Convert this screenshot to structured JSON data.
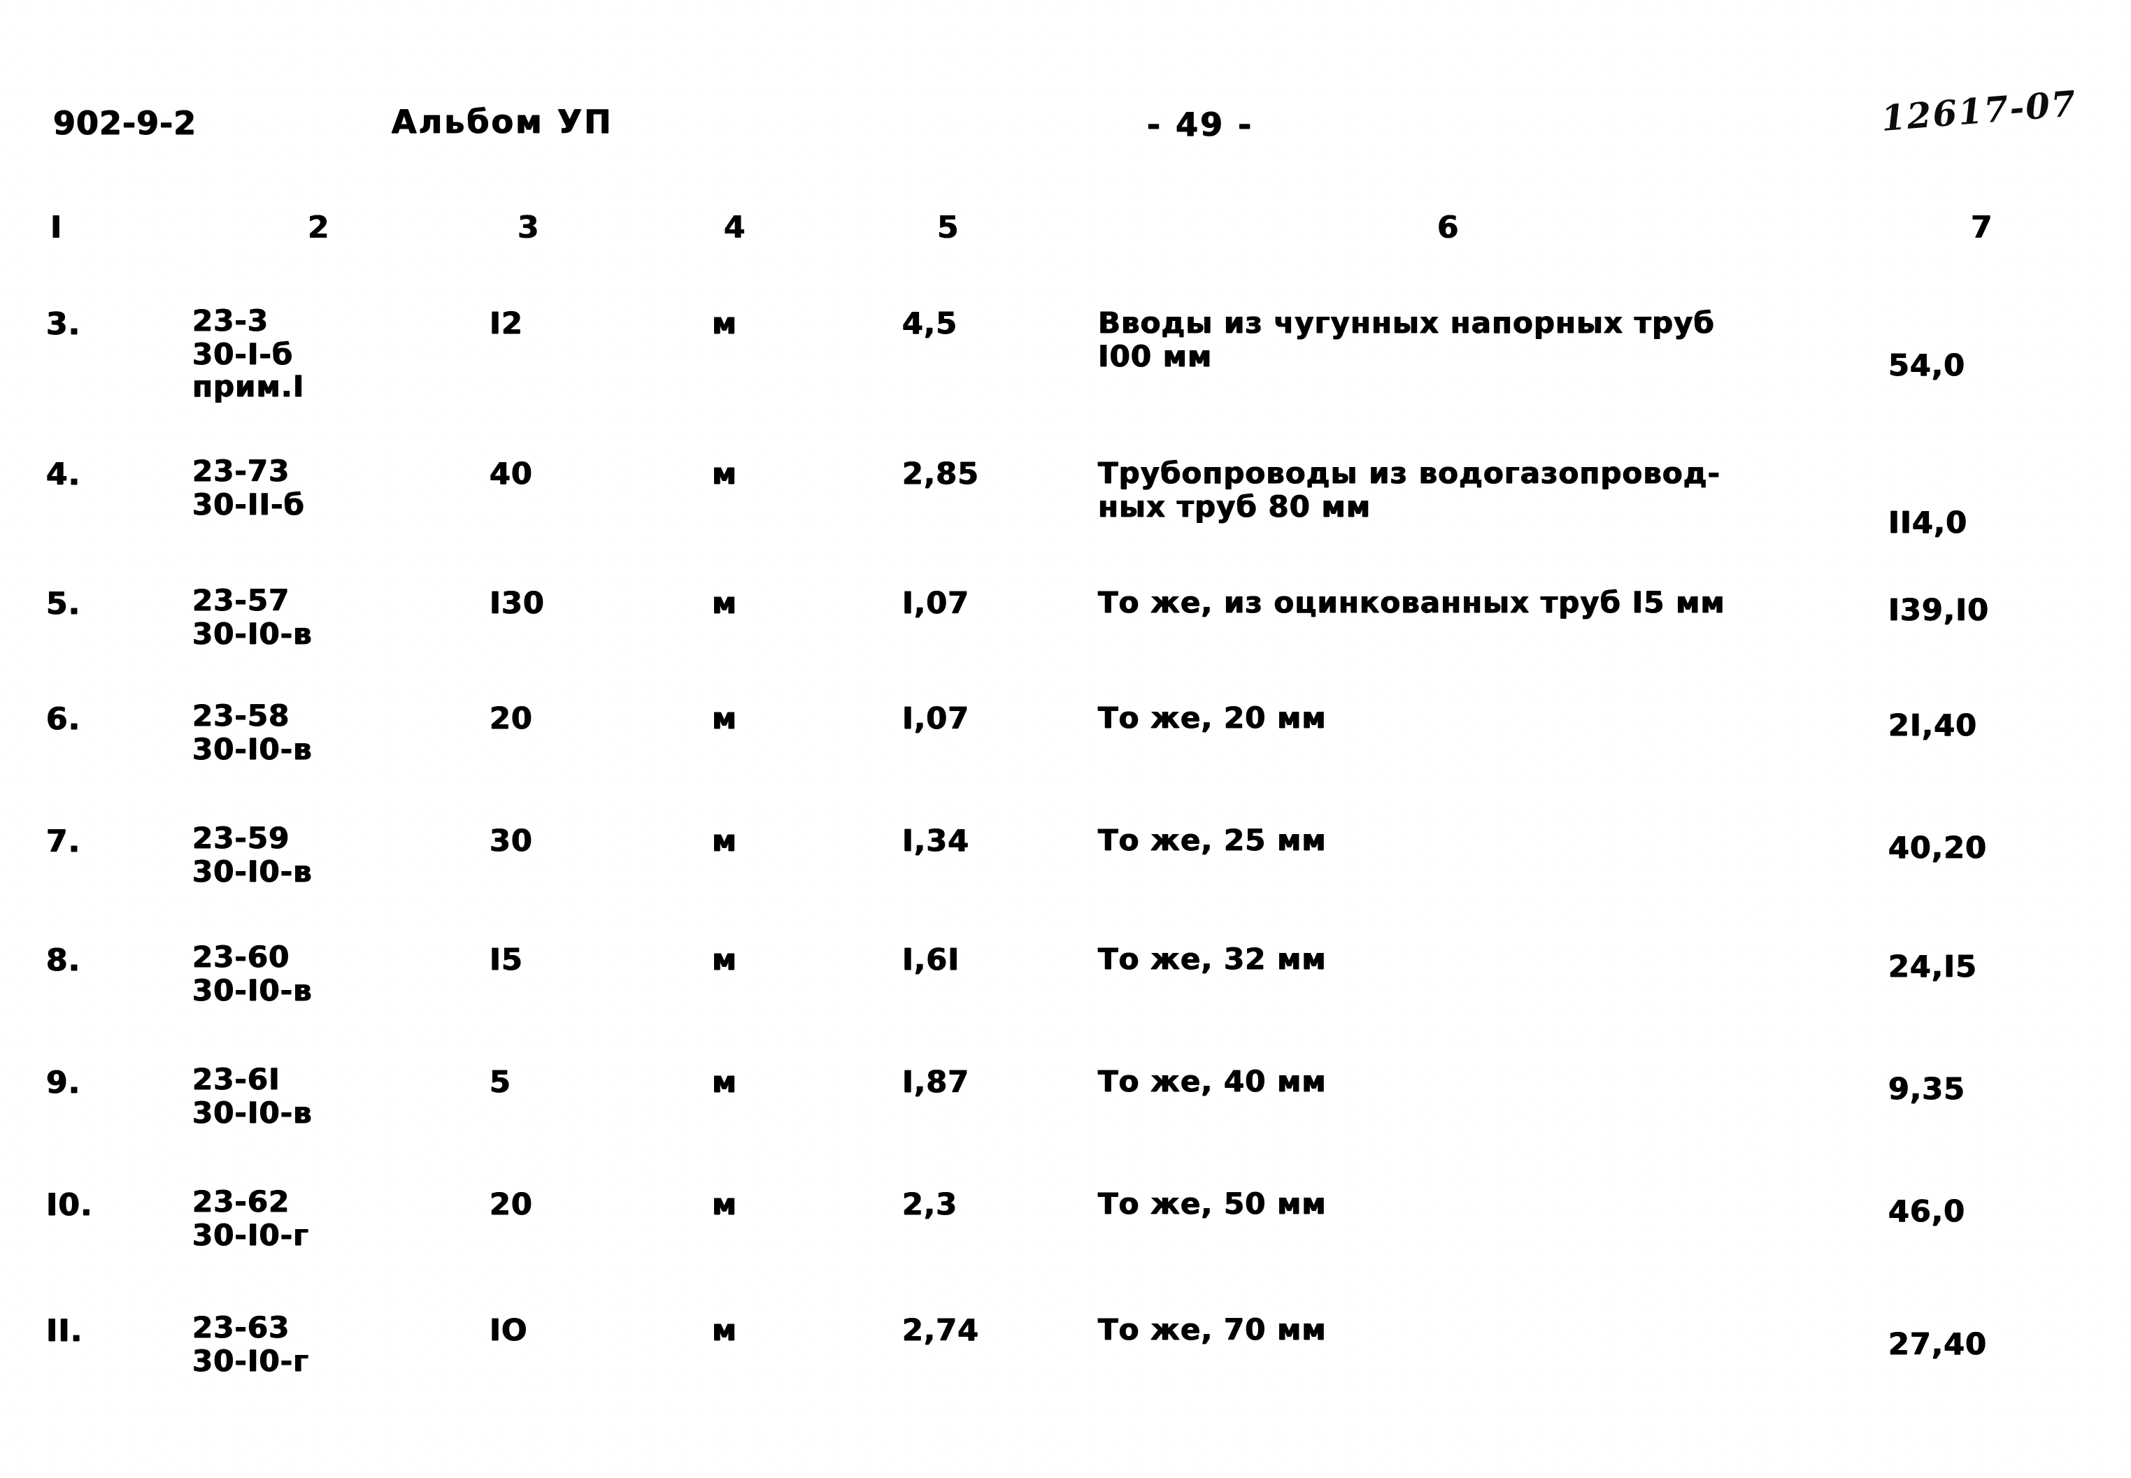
{
  "header": {
    "doc_code": "902-9-2",
    "album_label": "Альбом УП",
    "page_number": "- 49 -",
    "stamp": "12617-07"
  },
  "table": {
    "column_numbers": [
      "I",
      "2",
      "3",
      "4",
      "5",
      "6",
      "7"
    ],
    "rows": [
      {
        "no": "3.",
        "code_line1": "23-3",
        "code_line2": "30-I-б",
        "code_line3": "прим.I",
        "qty": "I2",
        "unit": "м",
        "rate": "4,5",
        "desc_line1": "Вводы из чугунных напорных труб",
        "desc_line2": "I00 мм",
        "total": "54,0"
      },
      {
        "no": "4.",
        "code_line1": "23-73",
        "code_line2": "30-II-б",
        "code_line3": "",
        "qty": "40",
        "unit": "м",
        "rate": "2,85",
        "desc_line1": "Трубопроводы из водогазопровод-",
        "desc_line2": "ных труб 80 мм",
        "total": "II4,0"
      },
      {
        "no": "5.",
        "code_line1": "23-57",
        "code_line2": "30-I0-в",
        "code_line3": "",
        "qty": "I30",
        "unit": "м",
        "rate": "I,07",
        "desc_line1": "То же, из оцинкованных труб I5 мм",
        "desc_line2": "",
        "total": "I39,I0"
      },
      {
        "no": "6.",
        "code_line1": "23-58",
        "code_line2": "30-I0-в",
        "code_line3": "",
        "qty": "20",
        "unit": "м",
        "rate": "I,07",
        "desc_line1": "То же, 20 мм",
        "desc_line2": "",
        "total": "2I,40"
      },
      {
        "no": "7.",
        "code_line1": "23-59",
        "code_line2": "30-I0-в",
        "code_line3": "",
        "qty": "30",
        "unit": "м",
        "rate": "I,34",
        "desc_line1": "То же, 25 мм",
        "desc_line2": "",
        "total": "40,20"
      },
      {
        "no": "8.",
        "code_line1": "23-60",
        "code_line2": "30-I0-в",
        "code_line3": "",
        "qty": "I5",
        "unit": "м",
        "rate": "I,6I",
        "desc_line1": "То же, 32 мм",
        "desc_line2": "",
        "total": "24,I5"
      },
      {
        "no": "9.",
        "code_line1": "23-6I",
        "code_line2": "30-I0-в",
        "code_line3": "",
        "qty": "5",
        "unit": "м",
        "rate": "I,87",
        "desc_line1": "То же, 40 мм",
        "desc_line2": "",
        "total": "9,35"
      },
      {
        "no": "I0.",
        "code_line1": "23-62",
        "code_line2": "30-I0-г",
        "code_line3": "",
        "qty": "20",
        "unit": "м",
        "rate": "2,3",
        "desc_line1": "То же, 50 мм",
        "desc_line2": "",
        "total": "46,0"
      },
      {
        "no": "II.",
        "code_line1": "23-63",
        "code_line2": "30-I0-г",
        "code_line3": "",
        "qty": "IO",
        "unit": "м",
        "rate": "2,74",
        "desc_line1": "То же, 70 мм",
        "desc_line2": "",
        "total": "27,40"
      }
    ]
  }
}
